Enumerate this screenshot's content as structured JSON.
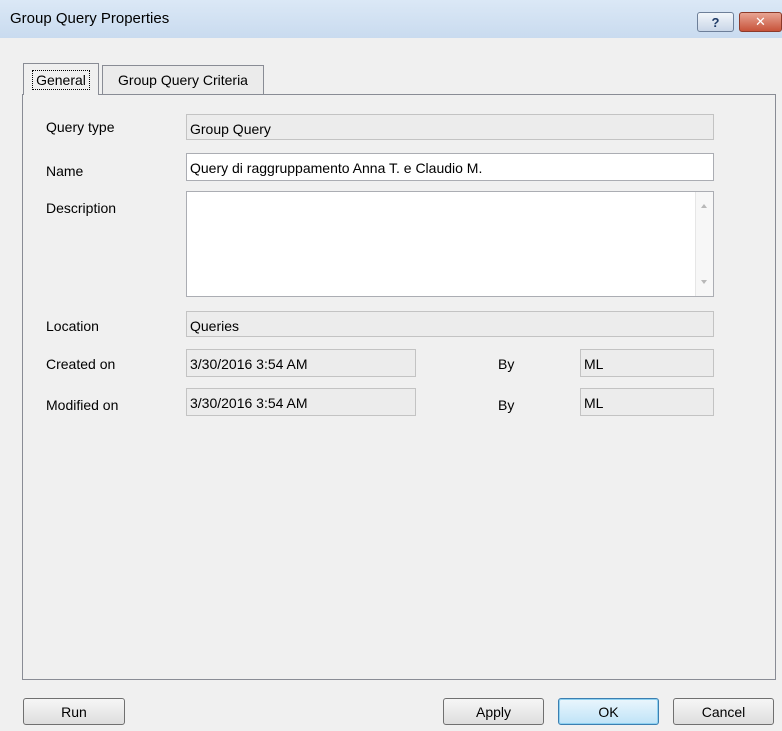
{
  "window": {
    "title": "Group Query Properties",
    "help_glyph": "?",
    "close_glyph": "✕"
  },
  "tabs": [
    {
      "label": "General",
      "active": true
    },
    {
      "label": "Group Query Criteria",
      "active": false
    }
  ],
  "form": {
    "query_type_label": "Query type",
    "query_type_value": "Group Query",
    "name_label": "Name",
    "name_value": "Query di raggruppamento Anna T. e Claudio M.",
    "description_label": "Description",
    "description_value": "",
    "location_label": "Location",
    "location_value": "Queries",
    "created_label": "Created on",
    "created_value": "3/30/2016 3:54 AM",
    "created_by_label": "By",
    "created_by_value": "ML",
    "modified_label": "Modified on",
    "modified_value": "3/30/2016 3:54 AM",
    "modified_by_label": "By",
    "modified_by_value": "ML"
  },
  "buttons": {
    "run": "Run",
    "apply": "Apply",
    "ok": "OK",
    "cancel": "Cancel"
  },
  "colors": {
    "titlebar": "#c9dbef",
    "close_button": "#c7533a",
    "dialog_bg": "#f0f0f0"
  }
}
